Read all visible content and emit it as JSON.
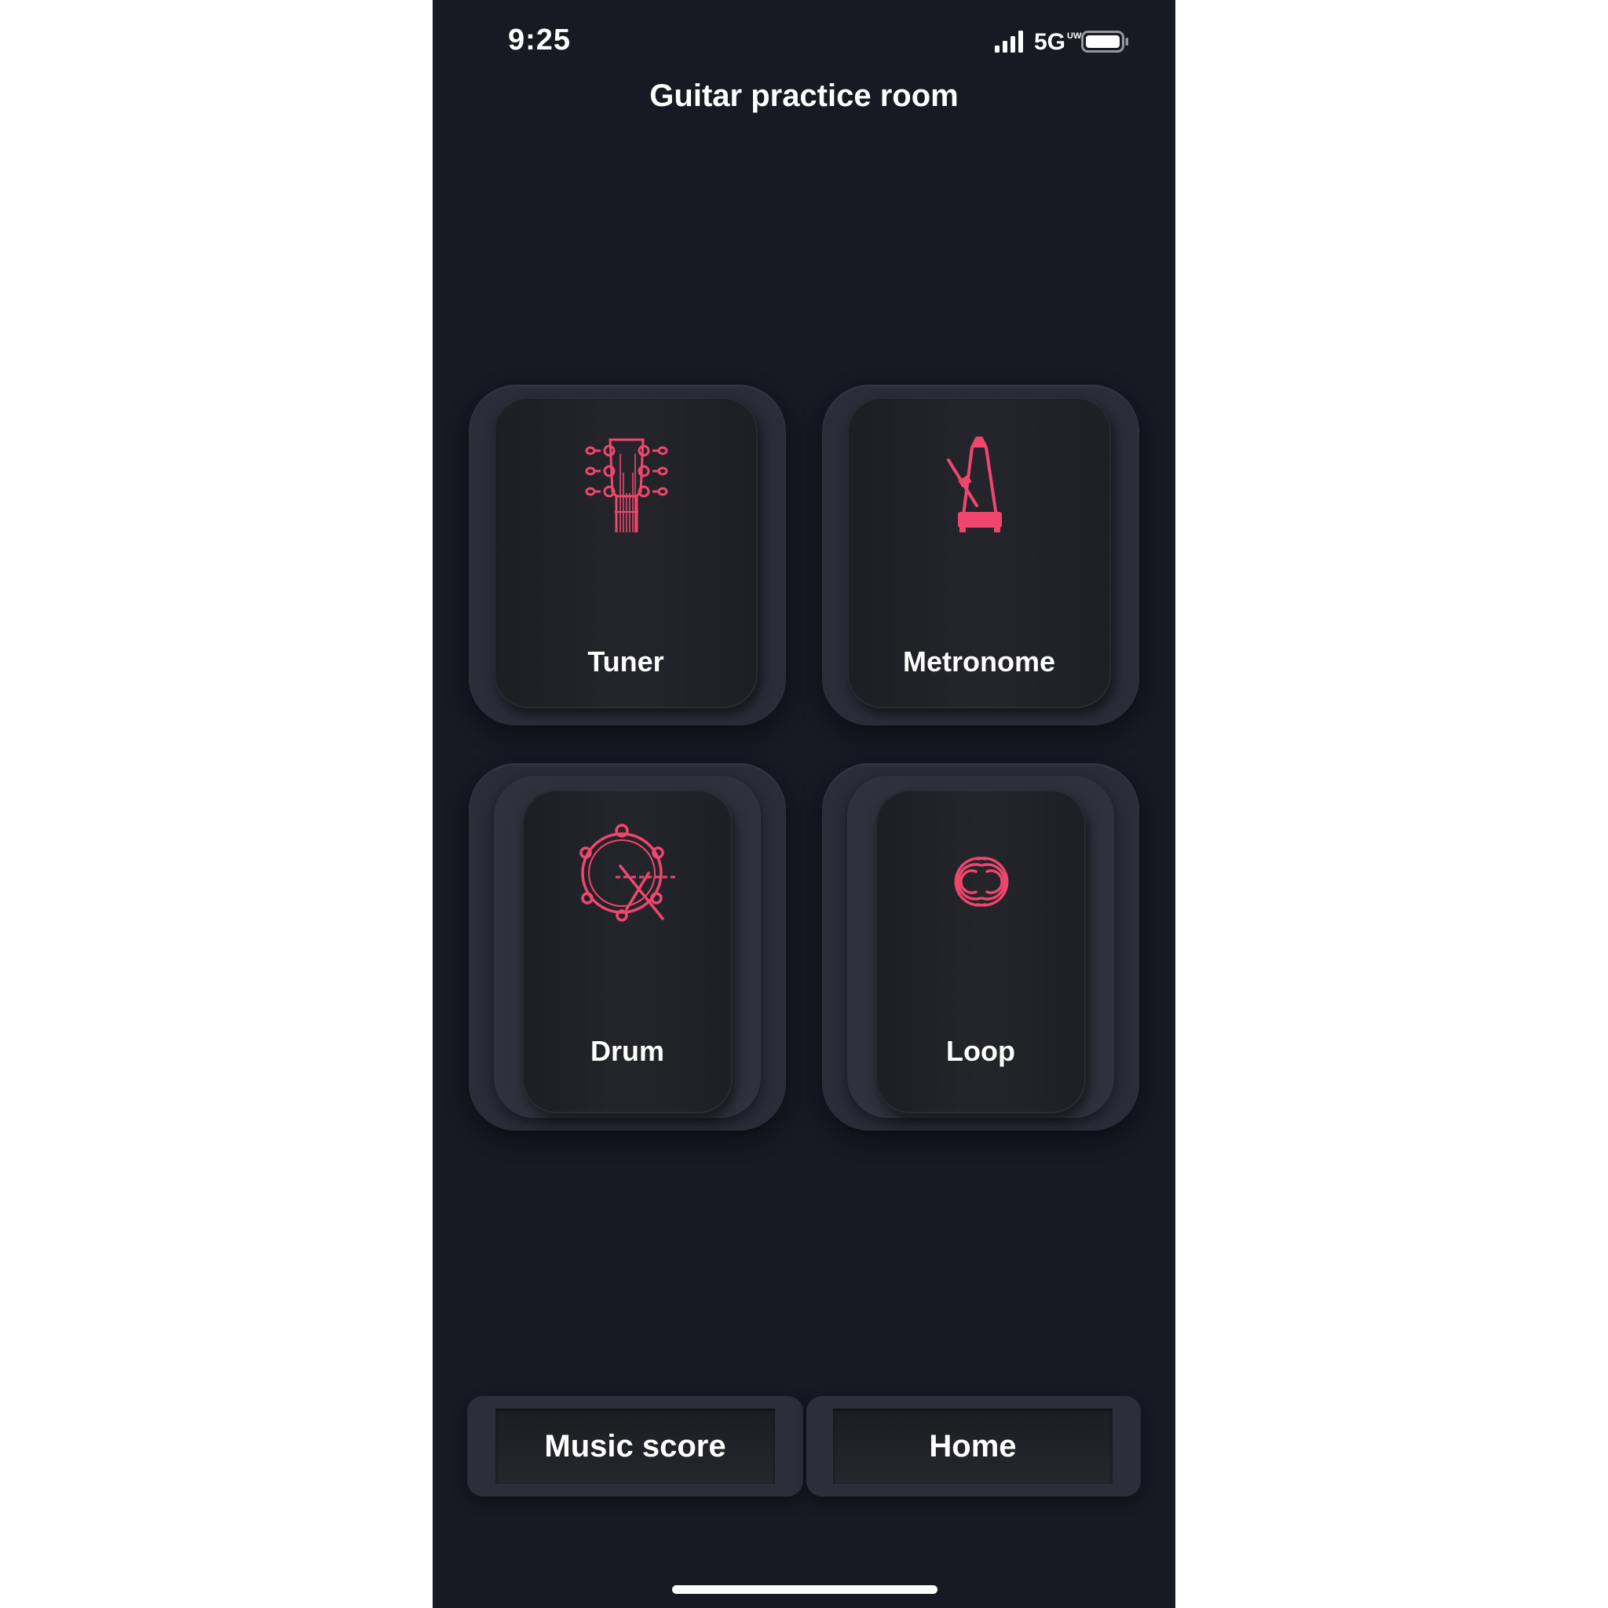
{
  "status_bar": {
    "time": "9:25",
    "network": "5G",
    "network_superscript": "UW"
  },
  "header": {
    "title": "Guitar practice room"
  },
  "tiles": [
    {
      "label": "Tuner",
      "icon": "guitar-headstock-icon"
    },
    {
      "label": "Metronome",
      "icon": "metronome-icon"
    },
    {
      "label": "Drum",
      "icon": "drum-icon"
    },
    {
      "label": "Loop",
      "icon": "loop-icon"
    }
  ],
  "bottom_nav": {
    "music_score_label": "Music score",
    "home_label": "Home"
  },
  "colors": {
    "background": "#171923",
    "accent": "#f0466e",
    "text": "#ffffff"
  }
}
